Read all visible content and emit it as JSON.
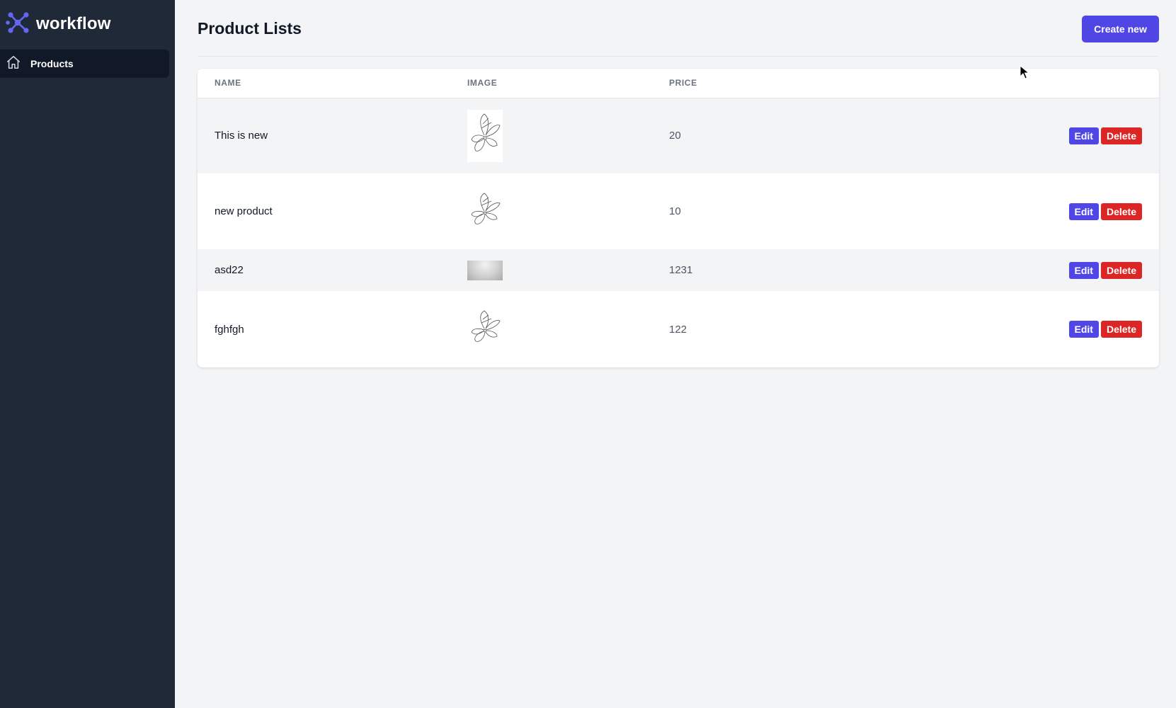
{
  "sidebar": {
    "brand": {
      "name": "workflow",
      "logo_color": "#6366f1"
    },
    "nav": [
      {
        "label": "Products",
        "icon": "home-icon",
        "active": true
      }
    ]
  },
  "header": {
    "title": "Product Lists",
    "create_label": "Create new"
  },
  "table": {
    "columns": [
      "NAME",
      "IMAGE",
      "PRICE"
    ],
    "rows": [
      {
        "name": "This is new",
        "image": "butterfly-sketch-thumbnail",
        "price": "20"
      },
      {
        "name": "new product",
        "image": "butterfly-sketch-thumbnail",
        "price": "10"
      },
      {
        "name": "asd22",
        "image": "gray-gradient-thumbnail",
        "price": "1231"
      },
      {
        "name": "fghfgh",
        "image": "butterfly-sketch-thumbnail",
        "price": "122"
      }
    ],
    "actions": {
      "edit_label": "Edit",
      "delete_label": "Delete"
    }
  },
  "colors": {
    "sidebar_bg": "#1f2937",
    "active_nav_bg": "#111827",
    "primary": "#4f46e5",
    "danger": "#dc2626",
    "page_bg": "#f3f4f6"
  }
}
